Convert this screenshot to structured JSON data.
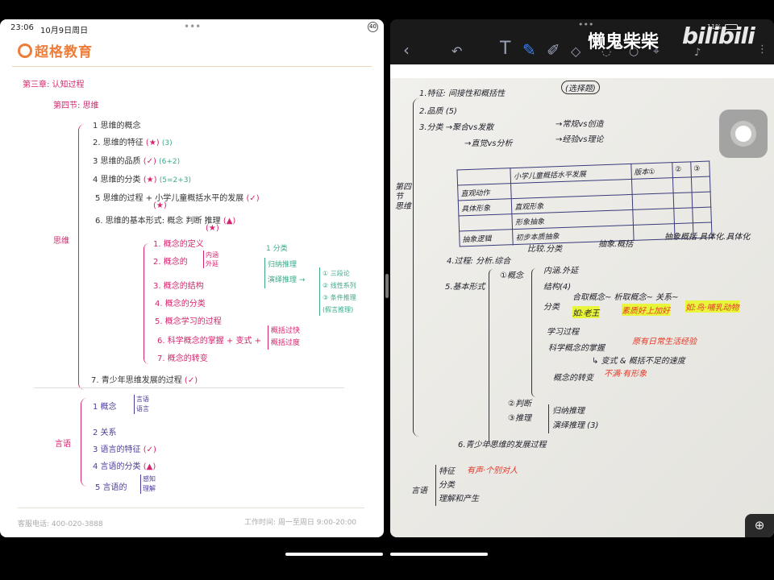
{
  "status": {
    "time": "23:06",
    "date": "10月9日周日",
    "battery": "11%"
  },
  "left": {
    "logo": "超格教育",
    "chapter": "第三章: 认知过程",
    "section": "第四节: 思维",
    "root_label": "思维",
    "items": [
      {
        "text": "1  思维的概念",
        "mark": "",
        "note": ""
      },
      {
        "text": "2. 思维的特征",
        "mark": "(★)",
        "note": "(3)"
      },
      {
        "text": "3  思维的品质",
        "mark": "(✓)",
        "note": "(6+2)"
      },
      {
        "text": "4  思维的分类",
        "mark": "(★)",
        "note": "(5=2+3)"
      },
      {
        "text": "5  思维的过程 + 小学儿童概括水平的发展",
        "mark": "(✓)",
        "note": "(★)"
      },
      {
        "text": "6. 思维的基本形式: 概念  判断  推理",
        "mark": "(▲)",
        "note": "(★)"
      }
    ],
    "concept_items": [
      "1. 概念的定义",
      "2. 概念的",
      "3. 概念的结构",
      "4. 概念的分类",
      "5. 概念学习的过程",
      "6. 科学概念的掌握 + 变式 +",
      "7. 概念的转变"
    ],
    "concept_sub": [
      "内涵",
      "外延"
    ],
    "concept_sub6": [
      "概括过快",
      "概括过度"
    ],
    "reasoning": {
      "head": "1  分类",
      "items": [
        "归纳推理",
        "演绎推理 →"
      ],
      "sub": [
        "① 三段论",
        "② 线性系列",
        "③ 条件推理",
        "(假言推理)"
      ]
    },
    "item7": "7. 青少年思维发展的过程",
    "item7_mark": "(✓)",
    "language_label": "言语",
    "language_items": [
      {
        "text": "1  概念",
        "sub": [
          "言语",
          "语言"
        ],
        "mark": ""
      },
      {
        "text": "2  关系",
        "sub": [],
        "mark": ""
      },
      {
        "text": "3  语言的特征",
        "sub": [],
        "mark": "(✓)"
      },
      {
        "text": "4  言语的分类",
        "sub": [],
        "mark": "(▲)"
      },
      {
        "text": "5  言语的",
        "sub": [
          "感知",
          "理解"
        ],
        "mark": ""
      }
    ],
    "footer": {
      "phone": "客服电话: 400-020-3888",
      "hours": "工作时间: 周一至周日 9:00-20:00"
    }
  },
  "right": {
    "watermark": "懒鬼柴柴",
    "brand": "bilibili",
    "toolbar": [
      "back",
      "undo",
      "text",
      "pen",
      "highlighter",
      "eraser",
      "lasso",
      "shapes",
      "image",
      "mic",
      "more"
    ],
    "notes": {
      "side_label": "第四节 思维",
      "tag": "(选择题)",
      "l1": "1.特征: 间接性和概括性",
      "l2": "2.品质 (5)",
      "l3a": "3.分类  →聚合vs发散",
      "l3b": "→常规vs创造",
      "l3c": "→直觉vs分析",
      "l3d": "→经验vs理论",
      "table": {
        "header": [
          "",
          "小学儿童概括水平发展",
          "版本①",
          "②",
          "③"
        ],
        "rows": [
          [
            "",
            ""
          ],
          [
            "直观动作",
            ""
          ],
          [
            "具体形象",
            "直观形象"
          ],
          [
            "",
            "形象抽象"
          ],
          [
            "抽象逻辑",
            "初步本质抽象"
          ]
        ]
      },
      "under": [
        "比较.分类",
        "抽象.概括",
        "抽象概括 具体化.具体化"
      ],
      "l4": "4.过程: 分析.综合",
      "l5": "5.基本形式",
      "concept": "①概念",
      "c1": "内涵.外延",
      "c2": "结构(4)",
      "c3": "分类",
      "c3a": "合取概念~   析取概念~   关系~",
      "c3b": [
        "如:老王",
        "素质好上加好",
        "如:鸟·哺乳动物"
      ],
      "c4": "学习过程",
      "c5": "科学概念的掌握",
      "c5r": "原有日常生活经验",
      "c6": "↳ 变式 & 概括不足的速度",
      "c7": "概念的转变",
      "c7r": "不满·有形象",
      "judge": "②判断",
      "infer": "③推理",
      "i1": "归纳推理",
      "i2": "演绎推理 (3)",
      "l6": "6.青少年思维的发展过程",
      "lang": "言语",
      "lang_items": [
        "特征",
        "分类",
        "理解和产生"
      ],
      "lang_red": "有声·个别对人"
    }
  }
}
